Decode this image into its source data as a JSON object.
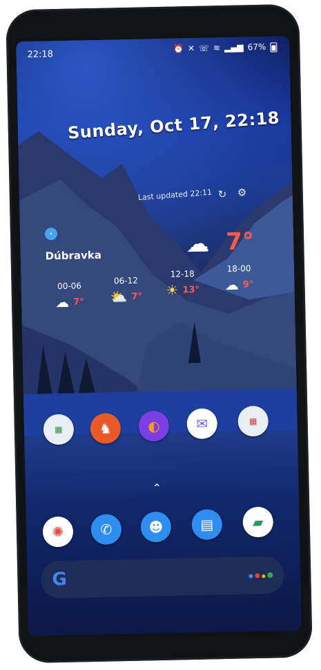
{
  "statusbar": {
    "time": "22:18",
    "battery": "67%"
  },
  "clock": {
    "date_text": "Sunday, Oct 17, 22:18"
  },
  "weather": {
    "last_updated": "Last updated 22:11",
    "location": "Dúbravka",
    "current_temp": "7°",
    "forecast": [
      {
        "time": "00-06",
        "temp": "7°",
        "icon": "cloud-icon"
      },
      {
        "time": "06-12",
        "temp": "7°",
        "icon": "sun-cloud-icon"
      },
      {
        "time": "12-18",
        "temp": "13°",
        "icon": "sun-icon"
      },
      {
        "time": "18-00",
        "temp": "9°",
        "icon": "moon-cloud-icon"
      }
    ]
  },
  "apps": {
    "row": [
      {
        "name": "folder-app"
      },
      {
        "name": "game-app"
      },
      {
        "name": "firefox-app"
      },
      {
        "name": "messenger-app"
      },
      {
        "name": "folder-app-2"
      }
    ],
    "dock": [
      {
        "name": "photos-app"
      },
      {
        "name": "phone-app"
      },
      {
        "name": "contacts-app"
      },
      {
        "name": "messages-app"
      },
      {
        "name": "files-app"
      }
    ]
  },
  "search": {
    "logo": "G"
  },
  "colors": {
    "temp_accent": "#ff5a4e",
    "search_bg": "#1d2d58"
  }
}
